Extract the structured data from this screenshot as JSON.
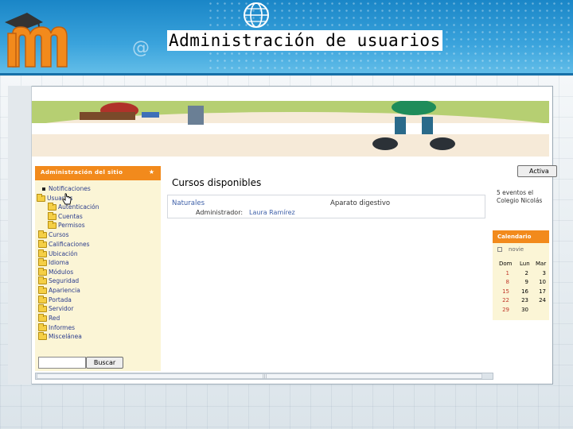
{
  "slide": {
    "title": "Administración de usuarios"
  },
  "admin_block": {
    "title": "Administración del sitio",
    "collapse_symbol": "★",
    "items": [
      {
        "label": "Notificaciones",
        "icon": "bullet-icon"
      },
      {
        "label": "Usuarios",
        "icon": "folder-open-icon"
      },
      {
        "label": "Autenticación",
        "icon": "folder-icon"
      },
      {
        "label": "Cuentas",
        "icon": "folder-icon"
      },
      {
        "label": "Permisos",
        "icon": "folder-icon"
      },
      {
        "label": "Cursos",
        "icon": "folder-icon"
      },
      {
        "label": "Calificaciones",
        "icon": "folder-icon"
      },
      {
        "label": "Ubicación",
        "icon": "folder-icon"
      },
      {
        "label": "Idioma",
        "icon": "folder-icon"
      },
      {
        "label": "Módulos",
        "icon": "folder-icon"
      },
      {
        "label": "Seguridad",
        "icon": "folder-icon"
      },
      {
        "label": "Apariencia",
        "icon": "folder-icon"
      },
      {
        "label": "Portada",
        "icon": "folder-icon"
      },
      {
        "label": "Servidor",
        "icon": "folder-icon"
      },
      {
        "label": "Red",
        "icon": "folder-icon"
      },
      {
        "label": "Informes",
        "icon": "folder-icon"
      },
      {
        "label": "Miscelánea",
        "icon": "folder-icon"
      }
    ],
    "search_button": "Buscar"
  },
  "courses": {
    "title": "Cursos disponibles",
    "items": [
      {
        "name": "Naturales",
        "description": "Aparato digestivo",
        "admin_label": "Administrador:",
        "admin_name": "Laura Ramírez"
      }
    ]
  },
  "right_column": {
    "activate_button": "Activa",
    "news": [
      "5 eventos el",
      "Colegio Nicolás"
    ],
    "calendar": {
      "title": "Calendario",
      "month": "novie",
      "headers": [
        "Dom",
        "Lun",
        "Mar"
      ],
      "rows": [
        [
          "1",
          "2",
          "3"
        ],
        [
          "8",
          "9",
          "10"
        ],
        [
          "15",
          "16",
          "17"
        ],
        [
          "22",
          "23",
          "24"
        ],
        [
          "29",
          "30",
          ""
        ]
      ]
    }
  },
  "colors": {
    "header_blue": "#1a86c7",
    "block_orange": "#f28a1c",
    "block_cream": "#fbf5d6",
    "link_blue": "#3d5fa8"
  }
}
